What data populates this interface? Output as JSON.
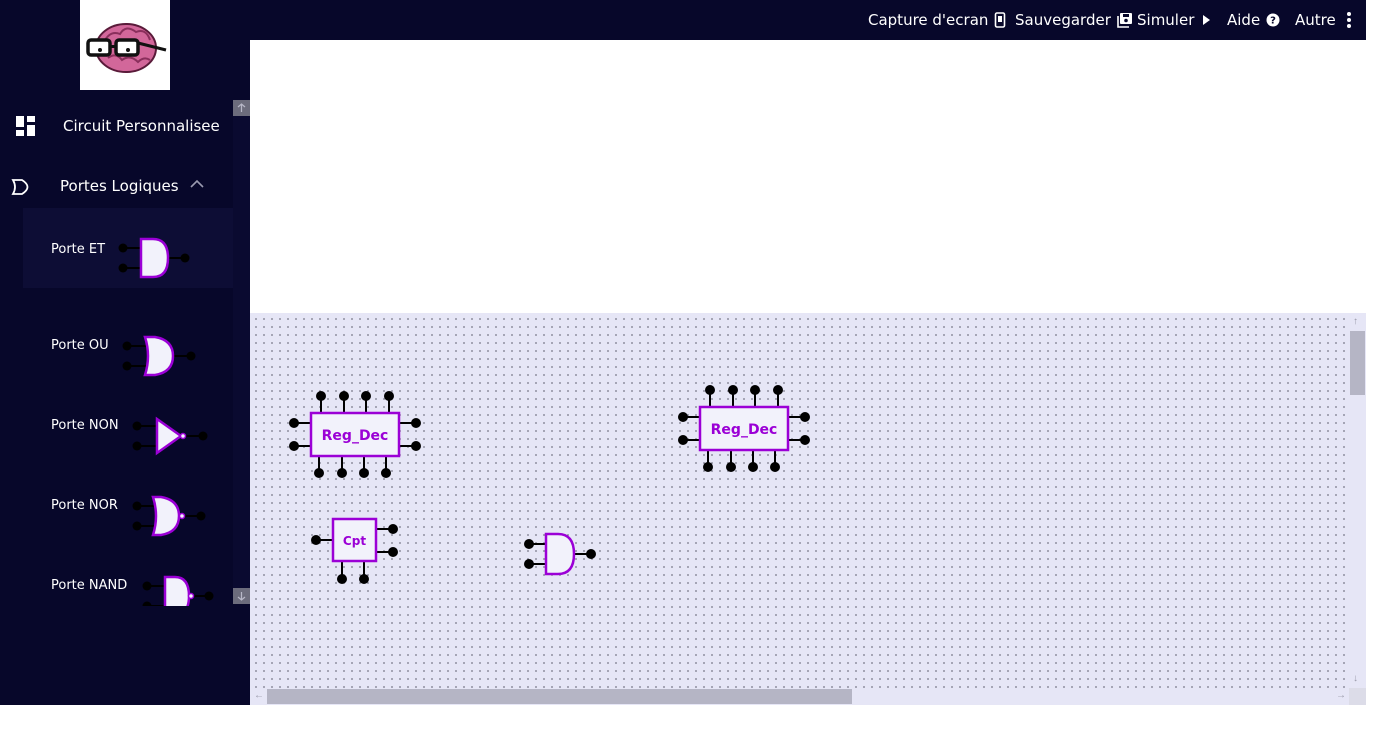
{
  "topbar": {
    "screenshot_label": "Capture d'ecran",
    "save_label": "Sauvegarder",
    "simulate_label": "Simuler",
    "help_label": "Aide",
    "more_label": "Autre"
  },
  "sidebar": {
    "custom_circuit_label": "Circuit Personnalisee",
    "logic_gates_label": "Portes Logiques",
    "gates": [
      {
        "label": "Porte ET"
      },
      {
        "label": "Porte OU"
      },
      {
        "label": "Porte NON"
      },
      {
        "label": "Porte NOR"
      },
      {
        "label": "Porte NAND"
      }
    ]
  },
  "canvas": {
    "components": [
      {
        "type": "Reg_Dec",
        "label": "Reg_Dec"
      },
      {
        "type": "Reg_Dec",
        "label": "Reg_Dec"
      },
      {
        "type": "Cpt",
        "label": "Cpt"
      },
      {
        "type": "AND",
        "label": ""
      }
    ]
  },
  "colors": {
    "dark_navy": "#07072a",
    "accent_purple": "#9b00d6",
    "canvas_bg": "#e6e6f6"
  }
}
